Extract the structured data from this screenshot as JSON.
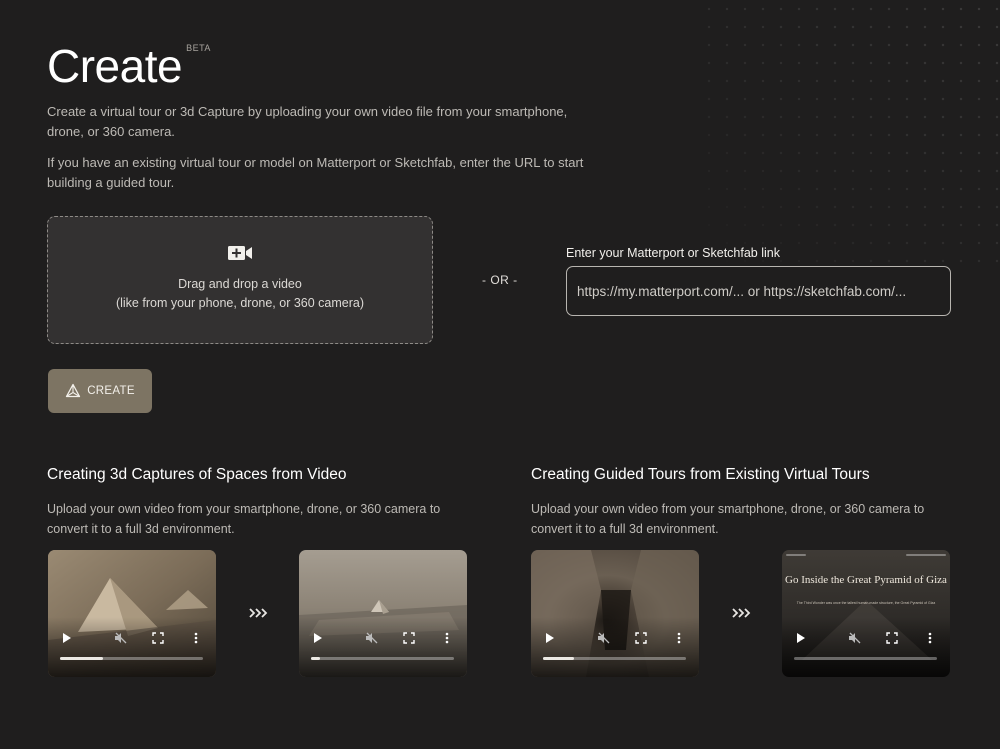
{
  "header": {
    "title": "Create",
    "badge": "BETA"
  },
  "intro": {
    "paragraph1": "Create a virtual tour or 3d Capture by uploading your own video file from your smartphone, drone, or 360 camera.",
    "paragraph2": "If you have an existing virtual tour or model on Matterport or Sketchfab, enter the URL to start building a guided tour."
  },
  "upload": {
    "icon": "video-add-icon",
    "line1": "Drag and drop a video",
    "line2": "(like from your phone, drone, or 360 camera)"
  },
  "separator": "- OR -",
  "link": {
    "label": "Enter your Matterport or Sketchfab link",
    "placeholder": "https://my.matterport.com/... or https://sketchfab.com/..."
  },
  "create_button": {
    "label": "CREATE",
    "icon": "pyramid-icon",
    "color": "#7d7463"
  },
  "sections": [
    {
      "title": "Creating 3d Captures of Spaces from Video",
      "description": "Upload your own video from your smartphone, drone, or 360 camera to convert it to a full 3d environment.",
      "videos": [
        {
          "progress": 0.3
        },
        {
          "progress": 0.06
        }
      ]
    },
    {
      "title": "Creating Guided Tours from Existing Virtual Tours",
      "description": "Upload your own video from your smartphone, drone, or 360 camera to convert it to a full 3d environment.",
      "videos": [
        {
          "progress": 0.22
        },
        {
          "progress": 0.0,
          "overlay_title": "Go Inside the Great Pyramid of Giza",
          "overlay_subtitle": "The Third Wonder was once the tallest human-made structure, the Great Pyramid of Giza"
        }
      ]
    }
  ],
  "video_controls": {
    "icons": [
      "play-icon",
      "mute-icon",
      "fullscreen-icon",
      "more-icon"
    ]
  }
}
